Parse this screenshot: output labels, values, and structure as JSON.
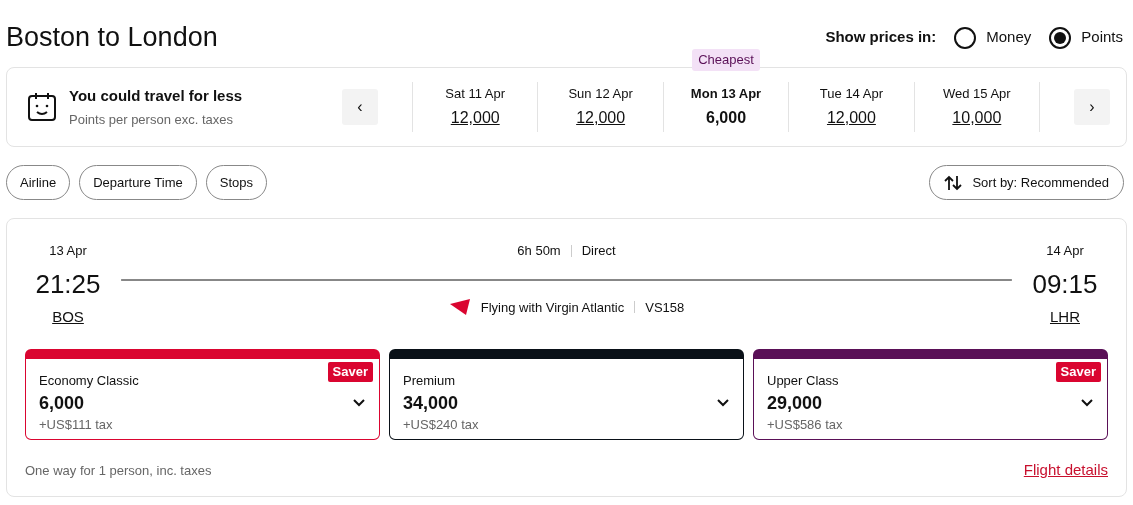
{
  "title": "Boston to London",
  "price_toggle": {
    "label": "Show prices in:",
    "options": [
      {
        "label": "Money",
        "selected": false
      },
      {
        "label": "Points",
        "selected": true
      }
    ]
  },
  "calendar": {
    "heading": "You could travel for less",
    "subheading": "Points per person exc. taxes",
    "prev": "‹",
    "next": "›",
    "dates": [
      {
        "day": "Sat 11 Apr",
        "price": "12,000",
        "selected": false
      },
      {
        "day": "Sun 12 Apr",
        "price": "12,000",
        "selected": false
      },
      {
        "day": "Mon 13 Apr",
        "price": "6,000",
        "selected": true,
        "badge": "Cheapest"
      },
      {
        "day": "Tue 14 Apr",
        "price": "12,000",
        "selected": false
      },
      {
        "day": "Wed 15 Apr",
        "price": "10,000",
        "selected": false
      }
    ]
  },
  "filters": [
    "Airline",
    "Departure Time",
    "Stops"
  ],
  "sort": "Sort by: Recommended",
  "flight": {
    "depart": {
      "date": "13 Apr",
      "time": "21:25",
      "airport": "BOS"
    },
    "arrive": {
      "date": "14 Apr",
      "time": "09:15",
      "airport": "LHR"
    },
    "duration": "6h 50m",
    "stops": "Direct",
    "operator": "Flying with Virgin Atlantic",
    "flight_number": "VS158",
    "cabins": [
      {
        "name": "Economy Classic",
        "price": "6,000",
        "tax": "+US$111 tax",
        "color": "#da0530",
        "badge": "Saver"
      },
      {
        "name": "Premium",
        "price": "34,000",
        "tax": "+US$240 tax",
        "color": "#0a1118"
      },
      {
        "name": "Upper Class",
        "price": "29,000",
        "tax": "+US$586 tax",
        "color": "#5a1057",
        "badge": "Saver"
      }
    ],
    "note": "One way for 1 person, inc. taxes",
    "details_link": "Flight details"
  }
}
